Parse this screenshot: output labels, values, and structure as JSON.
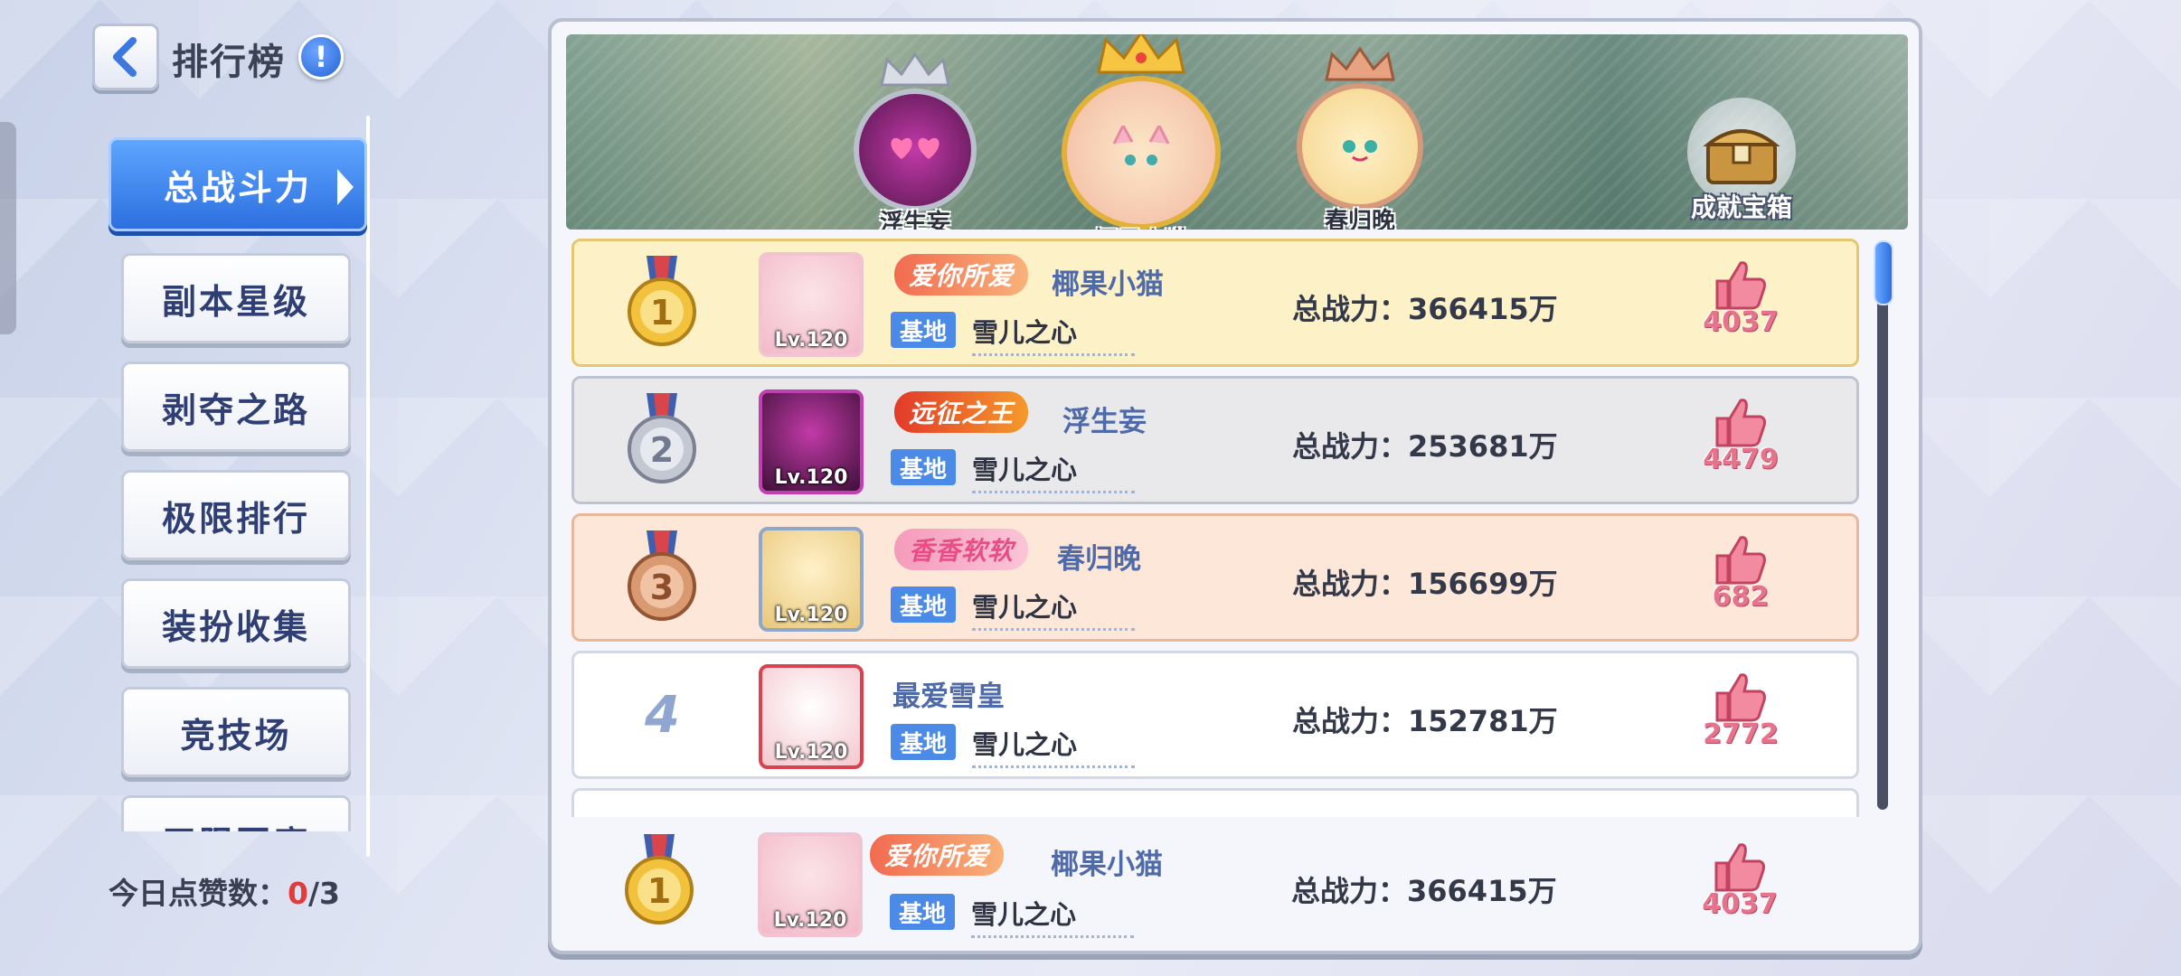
{
  "header": {
    "title": "排行榜",
    "info_icon": "!"
  },
  "sidebar": {
    "tabs": [
      {
        "label": "总战斗力",
        "active": true
      },
      {
        "label": "副本星级"
      },
      {
        "label": "剥夺之路"
      },
      {
        "label": "极限排行"
      },
      {
        "label": "装扮收集"
      },
      {
        "label": "竞技场"
      },
      {
        "label": "无限回廊"
      }
    ],
    "likes_label": "今日点赞数：",
    "likes_used": "0",
    "likes_total": "/3"
  },
  "banner": {
    "podium": [
      {
        "name": "浮生妄",
        "place": 2
      },
      {
        "name": "椰果小猫",
        "place": 1
      },
      {
        "name": "春归晚",
        "place": 3
      }
    ],
    "chest_label": "成就宝箱"
  },
  "rows": [
    {
      "rank": "1",
      "level": "Lv.120",
      "title": "爱你所爱",
      "name": "椰果小猫",
      "guild_tag": "基地",
      "guild": "雪儿之心",
      "power": "总战力：366415万",
      "likes": "4037"
    },
    {
      "rank": "2",
      "level": "Lv.120",
      "title": "远征之王",
      "name": "浮生妄",
      "guild_tag": "基地",
      "guild": "雪儿之心",
      "power": "总战力：253681万",
      "likes": "4479"
    },
    {
      "rank": "3",
      "level": "Lv.120",
      "title": "香香软软",
      "name": "春归晚",
      "guild_tag": "基地",
      "guild": "雪儿之心",
      "power": "总战力：156699万",
      "likes": "682"
    },
    {
      "rank": "4",
      "level": "Lv.120",
      "title": "",
      "name": "最爱雪皇",
      "guild_tag": "基地",
      "guild": "雪儿之心",
      "power": "总战力：152781万",
      "likes": "2772"
    }
  ],
  "self_row": {
    "rank": "1",
    "level": "Lv.120",
    "title": "爱你所爱",
    "name": "椰果小猫",
    "guild_tag": "基地",
    "guild": "雪儿之心",
    "power": "总战力：366415万",
    "likes": "4037"
  },
  "colors": {
    "accent": "#2d6fe0",
    "gold": "#e6b93a",
    "silver": "#b8bcc8",
    "bronze": "#c98a5e",
    "like_pink": "#e6738c"
  }
}
